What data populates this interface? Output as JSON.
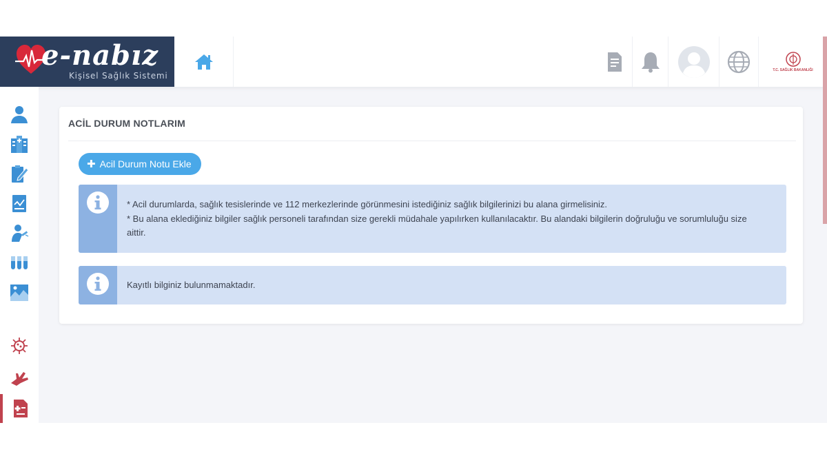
{
  "brand": {
    "title": "e-nabız",
    "subtitle": "Kişisel Sağlık Sistemi",
    "ministry_label": "T.C. SAĞLIK BAKANLIĞI"
  },
  "header": {
    "icons": [
      "home-icon",
      "document-icon",
      "bell-icon",
      "user-avatar-icon",
      "globe-icon",
      "ministry-logo"
    ]
  },
  "sidebar": {
    "icons": [
      "user-icon",
      "hospital-icon",
      "prescription-icon",
      "report-icon",
      "vaccine-icon",
      "test-tubes-icon",
      "radiology-icon",
      "virus-icon",
      "organ-donation-icon",
      "emergency-note-icon"
    ],
    "active": "emergency-note-icon"
  },
  "main": {
    "title": "ACİL DURUM NOTLARIM",
    "add_button_label": "Acil Durum Notu Ekle",
    "info_line_1": "* Acil durumlarda, sağlık tesislerinde ve 112 merkezlerinde görünmesini istediğiniz sağlık bilgilerinizi bu alana girmelisiniz.",
    "info_line_2": "* Bu alana eklediğiniz bilgiler sağlık personeli tarafından size gerekli müdahale yapılırken kullanılacaktır. Bu alandaki bilgilerin doğruluğu ve sorumluluğu size aittir.",
    "empty_message": "Kayıtlı bilginiz bulunmamaktadır."
  },
  "colors": {
    "brand_navy": "#2c3e5c",
    "accent_blue": "#4aa8e8",
    "alert_bg": "#d4e1f5",
    "alert_icon_bg": "#8db2e2",
    "active_red": "#c0424e"
  }
}
